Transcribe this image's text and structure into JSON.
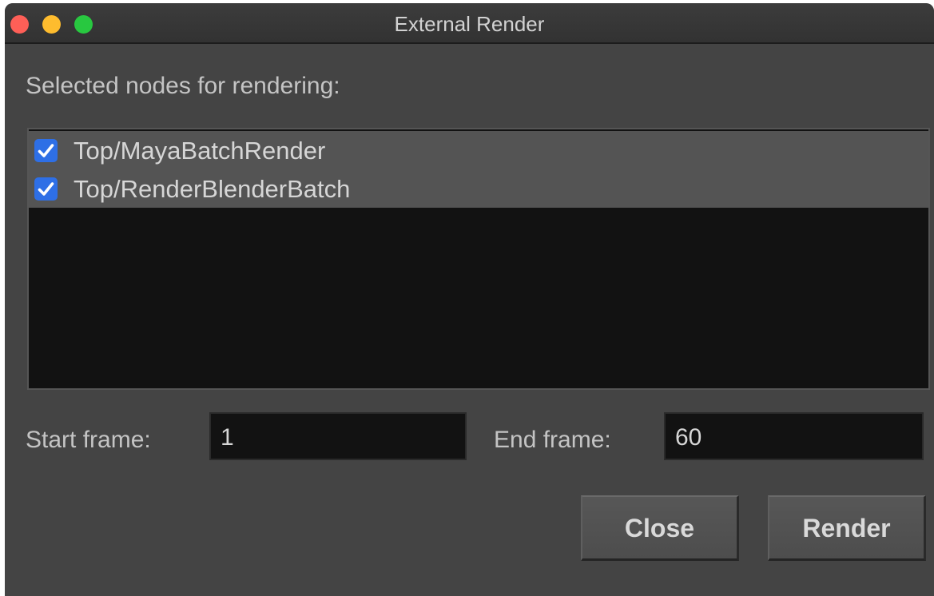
{
  "window": {
    "title": "External Render",
    "traffic_lights": {
      "close_color": "#fe5f57",
      "minimize_color": "#febc2e",
      "maximize_color": "#28c840"
    }
  },
  "nodes_section": {
    "label": "Selected nodes for rendering:",
    "items": [
      {
        "label": "Top/MayaBatchRender",
        "checked": true
      },
      {
        "label": "Top/RenderBlenderBatch",
        "checked": true
      }
    ]
  },
  "frames": {
    "start_label": "Start frame:",
    "start_value": "1",
    "end_label": "End frame:",
    "end_value": "60"
  },
  "buttons": {
    "close_label": "Close",
    "render_label": "Render"
  },
  "colors": {
    "checkbox_accent": "#2e6fe6",
    "window_bg": "#444444",
    "list_bg": "#121212"
  },
  "icons": {
    "checkbox_checked": "checkmark-icon"
  }
}
